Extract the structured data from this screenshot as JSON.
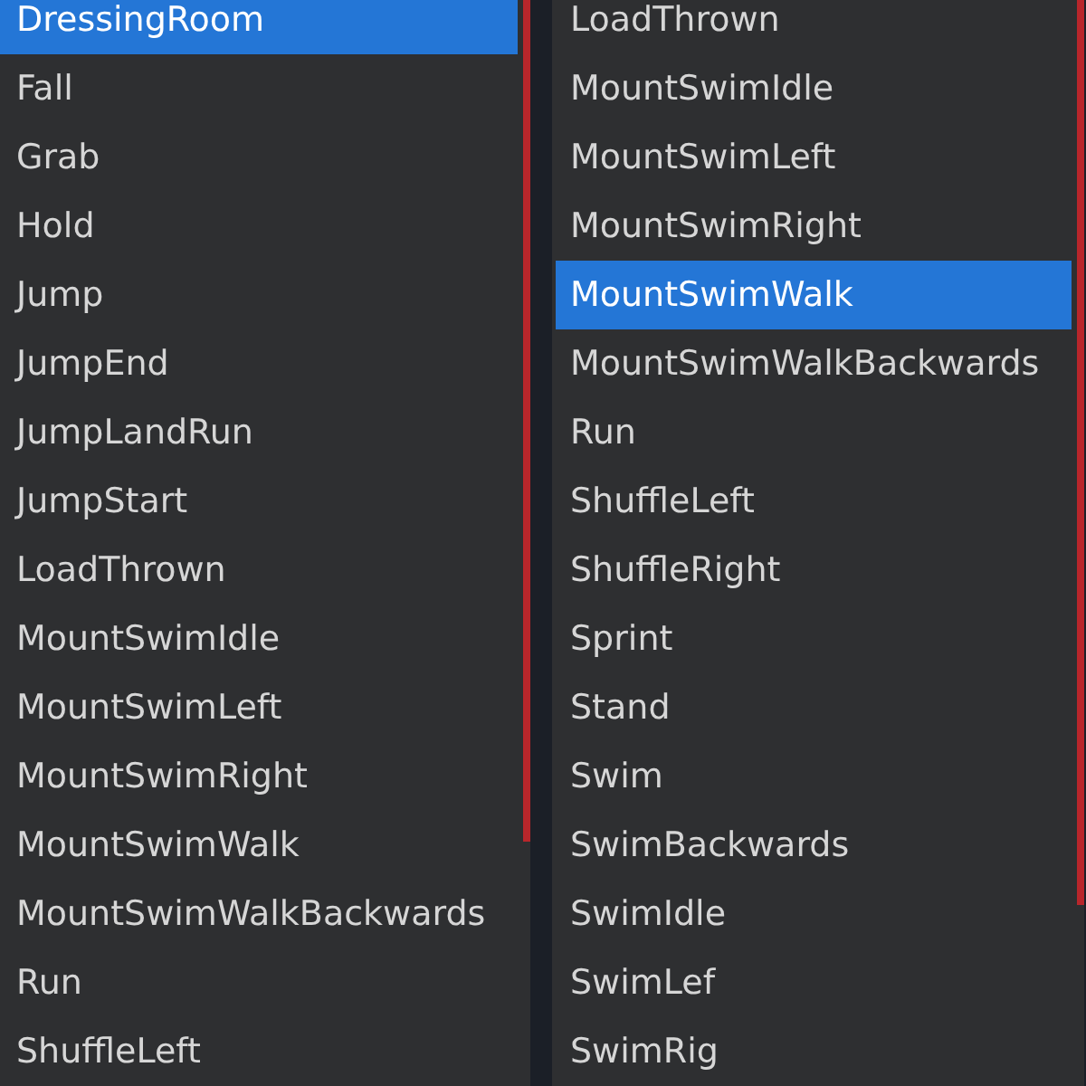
{
  "lists": [
    {
      "items": [
        {
          "label": "DressingRoom",
          "selected": true
        },
        {
          "label": "Fall",
          "selected": false
        },
        {
          "label": "Grab",
          "selected": false
        },
        {
          "label": "Hold",
          "selected": false
        },
        {
          "label": "Jump",
          "selected": false
        },
        {
          "label": "JumpEnd",
          "selected": false
        },
        {
          "label": "JumpLandRun",
          "selected": false
        },
        {
          "label": "JumpStart",
          "selected": false
        },
        {
          "label": "LoadThrown",
          "selected": false
        },
        {
          "label": "MountSwimIdle",
          "selected": false
        },
        {
          "label": "MountSwimLeft",
          "selected": false
        },
        {
          "label": "MountSwimRight",
          "selected": false
        },
        {
          "label": "MountSwimWalk",
          "selected": false
        },
        {
          "label": "MountSwimWalkBackwards",
          "selected": false
        },
        {
          "label": "Run",
          "selected": false
        },
        {
          "label": "ShuffleLeft",
          "selected": false
        }
      ]
    },
    {
      "items": [
        {
          "label": "LoadThrown",
          "selected": false
        },
        {
          "label": "MountSwimIdle",
          "selected": false
        },
        {
          "label": "MountSwimLeft",
          "selected": false
        },
        {
          "label": "MountSwimRight",
          "selected": false
        },
        {
          "label": "MountSwimWalk",
          "selected": true
        },
        {
          "label": "MountSwimWalkBackwards",
          "selected": false
        },
        {
          "label": "Run",
          "selected": false
        },
        {
          "label": "ShuffleLeft",
          "selected": false
        },
        {
          "label": "ShuffleRight",
          "selected": false
        },
        {
          "label": "Sprint",
          "selected": false
        },
        {
          "label": "Stand",
          "selected": false
        },
        {
          "label": "Swim",
          "selected": false
        },
        {
          "label": "SwimBackwards",
          "selected": false
        },
        {
          "label": "SwimIdle",
          "selected": false
        },
        {
          "label": "SwimLef",
          "selected": false
        },
        {
          "label": "SwimRig",
          "selected": false
        }
      ]
    }
  ]
}
